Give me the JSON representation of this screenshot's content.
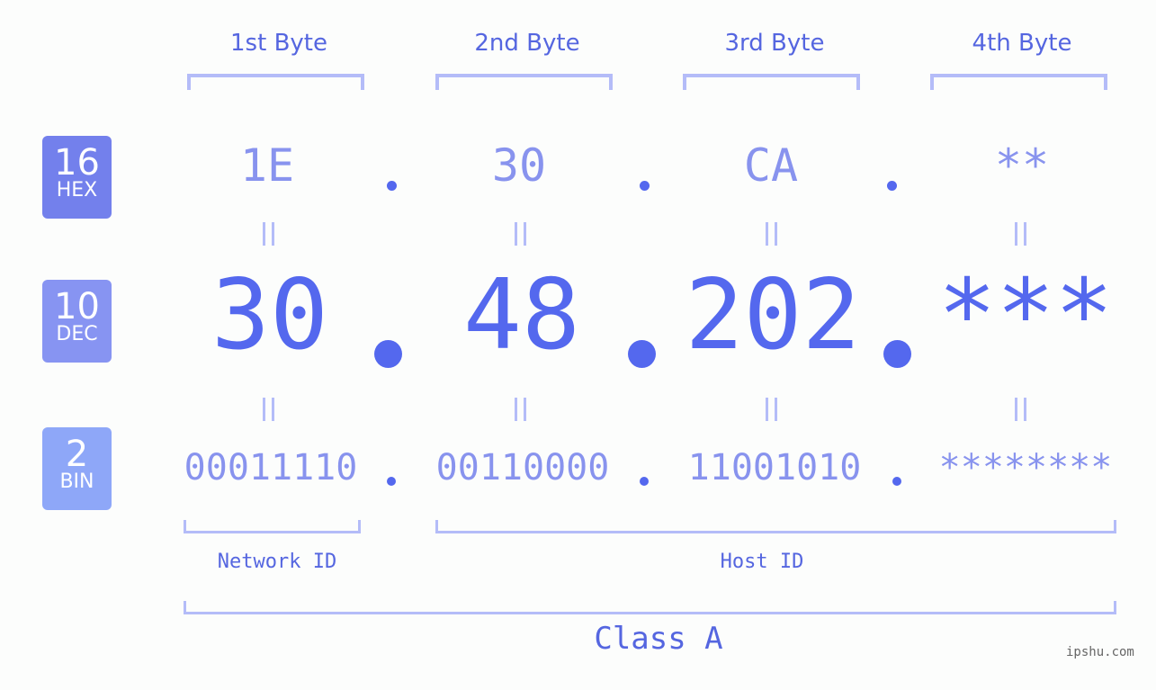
{
  "byte_headers": [
    "1st Byte",
    "2nd Byte",
    "3rd Byte",
    "4th Byte"
  ],
  "bases": [
    {
      "number": "16",
      "label": "HEX",
      "color": "#7380ec"
    },
    {
      "number": "10",
      "label": "DEC",
      "color": "#8794f2"
    },
    {
      "number": "2",
      "label": "BIN",
      "color": "#8ea7f8"
    }
  ],
  "hex_octets": [
    "1E",
    "30",
    "CA",
    "**"
  ],
  "dec_octets": [
    "30",
    "48",
    "202",
    "***"
  ],
  "bin_octets": [
    "00011110",
    "00110000",
    "11001010",
    "********"
  ],
  "network_label": "Network ID",
  "host_label": "Host ID",
  "class_label": "Class A",
  "site": "ipshu.com",
  "colors": {
    "accent": "#5468ee",
    "light": "#8893ee",
    "bracket": "#b4bcf8"
  }
}
